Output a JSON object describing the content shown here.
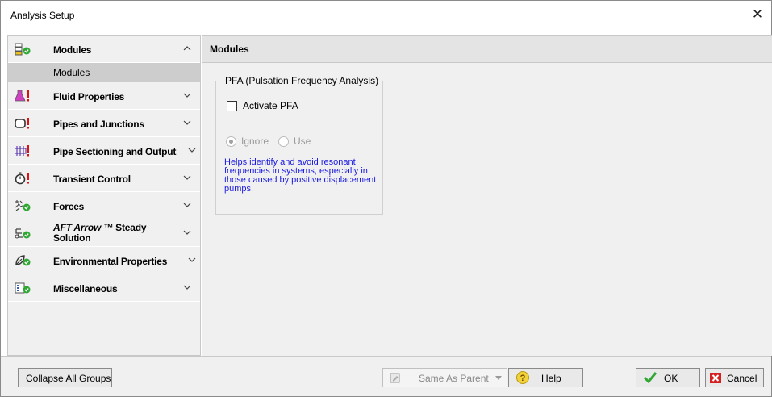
{
  "window": {
    "title": "Analysis Setup"
  },
  "sidebar": {
    "groups": [
      {
        "label": "Modules",
        "expanded": true,
        "icon": "modules-icon"
      },
      {
        "label": "Fluid Properties",
        "icon": "flask-warning-icon"
      },
      {
        "label": "Pipes and Junctions",
        "icon": "pipe-warning-icon"
      },
      {
        "label": "Pipe Sectioning and Output",
        "icon": "sectioning-warning-icon"
      },
      {
        "label": "Transient Control",
        "icon": "stopwatch-warning-icon"
      },
      {
        "label": "Forces",
        "icon": "forces-check-icon"
      },
      {
        "label_prefix": "AFT Arrow ™",
        "label_suffix": " Steady Solution",
        "icon": "steady-solution-check-icon"
      },
      {
        "label": "Environmental Properties",
        "icon": "environment-check-icon"
      },
      {
        "label": "Miscellaneous",
        "icon": "misc-check-icon"
      }
    ],
    "subitems": {
      "modules": "Modules"
    }
  },
  "panel": {
    "header": "Modules",
    "pfa": {
      "legend": "PFA (Pulsation Frequency Analysis)",
      "activate_label": "Activate PFA",
      "activate_checked": false,
      "option_ignore": "Ignore",
      "option_use": "Use",
      "selected": "Ignore",
      "help_text": "Helps identify and avoid resonant frequencies in systems, especially in those caused by positive displacement pumps."
    }
  },
  "footer": {
    "collapse_label": "Collapse All Groups",
    "parent_select": "Same As Parent",
    "help_label": "Help",
    "ok_label": "OK",
    "cancel_label": "Cancel"
  },
  "colors": {
    "warning": "#e01010",
    "check": "#2ea832",
    "help_text": "#1a1ae0",
    "selected_row": "#cdcdcd"
  }
}
